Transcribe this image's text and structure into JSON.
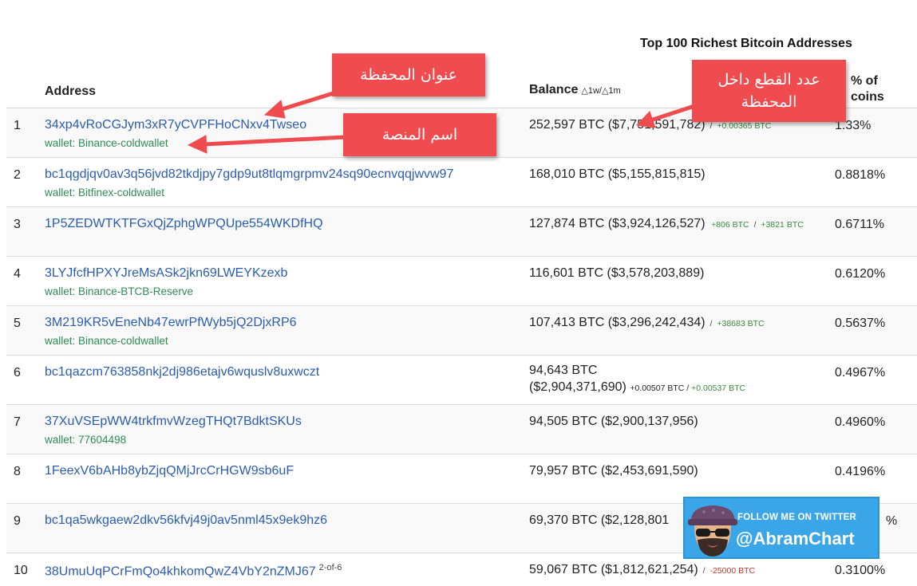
{
  "page_title": "Top 100 Richest Bitcoin Addresses",
  "table": {
    "headers": {
      "address": "Address",
      "balance": "Balance",
      "balance_delta": "△1w/△1m",
      "pct_line1": "% of",
      "pct_line2": "coins"
    },
    "rows": [
      {
        "rank": "1",
        "address": "34xp4vRoCGJym3xR7yCVPFHoCNxv4Twseo",
        "wallet": "wallet: Binance-coldwallet",
        "balance": "252,597 BTC ($7,751,591,782)",
        "delta_sep": "/",
        "delta_1": "+0.00365 BTC",
        "delta_2": "",
        "pct": "1.33%"
      },
      {
        "rank": "2",
        "address": "bc1qgdjqv0av3q56jvd82tkdjpy7gdp9ut8tlqmgrpmv24sq90ecnvqqjwvw97",
        "wallet": "wallet: Bitfinex-coldwallet",
        "balance": "168,010 BTC ($5,155,815,815)",
        "delta_sep": "",
        "delta_1": "",
        "delta_2": "",
        "pct": "0.8818%"
      },
      {
        "rank": "3",
        "address": "1P5ZEDWTKTFGxQjZphgWPQUpe554WKDfHQ",
        "wallet": "",
        "balance": "127,874 BTC ($3,924,126,527)",
        "delta_sep": "/",
        "delta_1": "+806 BTC",
        "delta_2": "+3821 BTC",
        "pct": "0.6711%"
      },
      {
        "rank": "4",
        "address": "3LYJfcfHPXYJreMsASk2jkn69LWEYKzexb",
        "wallet": "wallet: Binance-BTCB-Reserve",
        "balance": "116,601 BTC ($3,578,203,889)",
        "delta_sep": "",
        "delta_1": "",
        "delta_2": "",
        "pct": "0.6120%"
      },
      {
        "rank": "5",
        "address": "3M219KR5vEneNb47ewrPfWyb5jQ2DjxRP6",
        "wallet": "wallet: Binance-coldwallet",
        "balance": "107,413 BTC ($3,296,242,434)",
        "delta_sep": "/",
        "delta_1": "+38683 BTC",
        "delta_2": "",
        "pct": "0.5637%"
      },
      {
        "rank": "6",
        "address": "bc1qazcm763858nkj2dj986etajv6wquslv8uxwczt",
        "wallet": "",
        "balance": "94,643 BTC",
        "balance_line2": "($2,904,371,690)",
        "delta_sep": "/",
        "delta_1": "+0.00507 BTC",
        "delta_2": "+0.00537 BTC",
        "pct": "0.4967%"
      },
      {
        "rank": "7",
        "address": "37XuVSEpWW4trkfmvWzegTHQt7BdktSKUs",
        "wallet": "wallet: 77604498",
        "balance": "94,505 BTC ($2,900,137,956)",
        "delta_sep": "",
        "delta_1": "",
        "delta_2": "",
        "pct": "0.4960%"
      },
      {
        "rank": "8",
        "address": "1FeexV6bAHb8ybZjqQMjJrcCrHGW9sb6uF",
        "wallet": "",
        "balance": "79,957 BTC ($2,453,691,590)",
        "delta_sep": "",
        "delta_1": "",
        "delta_2": "",
        "pct": "0.4196%"
      },
      {
        "rank": "9",
        "address": "bc1qa5wkgaew2dkv56kfvj49j0av5nml45x9ek9hz6",
        "wallet": "",
        "balance": "69,370 BTC ($2,128,801",
        "delta_sep": "",
        "delta_1": "",
        "delta_2": "",
        "pct": "%"
      },
      {
        "rank": "10",
        "address": "38UmuUqPCrFmQo4khkomQwZ4VbY2nZMJ67",
        "address_sup": "2-of-6",
        "wallet": "",
        "balance": "59,067 BTC ($1,812,621,254)",
        "delta_sep": "/",
        "delta_1": "-25000 BTC",
        "delta_2": "",
        "pct": "0.3100%"
      }
    ]
  },
  "annotations": {
    "wallet_address": "عنوان المحفظة",
    "exchange_name": "اسم المنصة",
    "coins_in_wallet_line1": "عدد القطع داخل",
    "coins_in_wallet_line2": "المحفظة",
    "color": "#f04b4f"
  },
  "badge": {
    "follow_text": "FOLLOW ME ON TWITTER",
    "handle": "@AbramChart",
    "color": "#3aa6e8"
  }
}
